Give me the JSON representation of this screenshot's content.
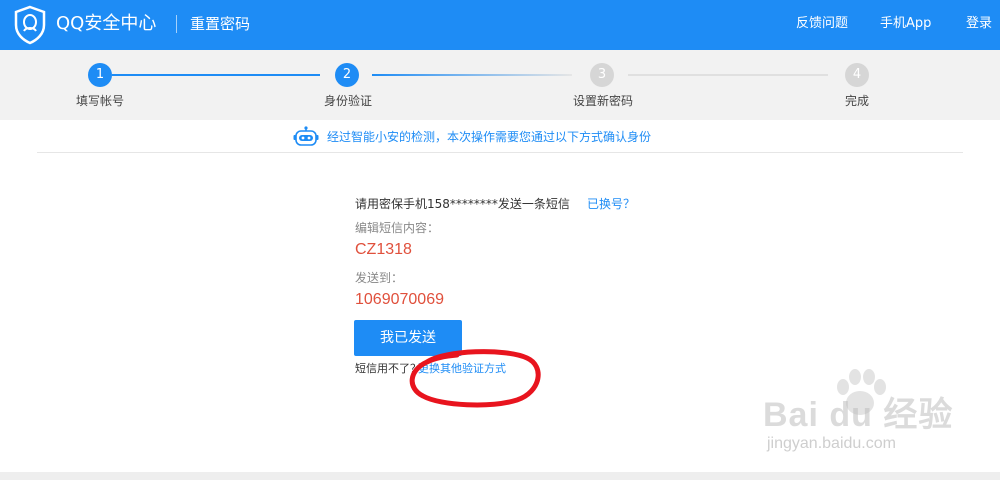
{
  "header": {
    "brand": "QQ安全中心",
    "page_name": "重置密码",
    "nav": {
      "feedback": "反馈问题",
      "app": "手机App",
      "login": "登录"
    },
    "logo_icon": "qq-shield-icon",
    "color": "#1e8cf5"
  },
  "steps": [
    {
      "number": "1",
      "label": "填写帐号",
      "state": "done"
    },
    {
      "number": "2",
      "label": "身份验证",
      "state": "active"
    },
    {
      "number": "3",
      "label": "设置新密码",
      "state": "pending"
    },
    {
      "number": "4",
      "label": "完成",
      "state": "pending"
    }
  ],
  "notice": {
    "icon": "robot-icon",
    "text": "经过智能小安的检测，本次操作需要您通过以下方式确认身份"
  },
  "form": {
    "instruction": "请用密保手机158********发送一条短信",
    "change_number": "已换号？",
    "content_label": "编辑短信内容：",
    "content_value": "CZ1318",
    "send_to_label": "发送到：",
    "send_to_value": "1069070069",
    "sent_button": "我已发送",
    "alt_prefix": "短信用不了？",
    "alt_link": "更换其他验证方式",
    "value_color": "#e0503c"
  },
  "watermark": {
    "logo": "Bai du 经验",
    "url": "jingyan.baidu.com"
  }
}
